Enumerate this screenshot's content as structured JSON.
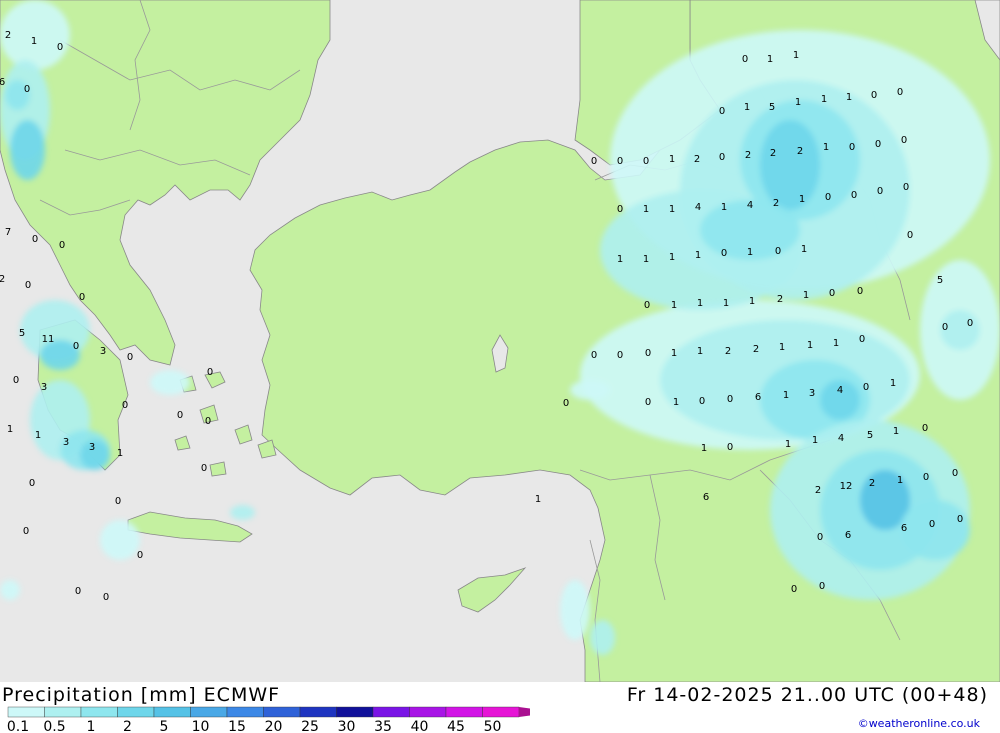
{
  "header": {
    "title": "Precipitation [mm] ECMWF",
    "valid_time": "Fr 14-02-2025 21..00 UTC (00+48)",
    "credit": "©weatheronline.co.uk"
  },
  "colors": {
    "sea": "#e8e8e8",
    "land": "#c4f0a0",
    "border": "#999999",
    "coast": "#888888"
  },
  "legend": {
    "ticks": [
      "0.1",
      "0.5",
      "1",
      "2",
      "5",
      "10",
      "15",
      "20",
      "25",
      "30",
      "35",
      "40",
      "45",
      "50"
    ],
    "colors": [
      "#cdf8f8",
      "#aef0f0",
      "#8ee6ee",
      "#6ed6ea",
      "#55c2e6",
      "#4aa8e6",
      "#3c88e6",
      "#2f62d8",
      "#1e34c0",
      "#11119a",
      "#7a14e6",
      "#a814e6",
      "#d214e6",
      "#e614d6",
      "#aa1090"
    ]
  },
  "values": [
    "2",
    "1",
    "0",
    "6",
    "0",
    "7",
    "0",
    "0",
    "2",
    "0",
    "0",
    "5",
    "11",
    "0",
    "3",
    "0",
    "0",
    "3",
    "0",
    "0",
    "1",
    "1",
    "3",
    "3",
    "1",
    "0",
    "0",
    "0",
    "0",
    "0",
    "0",
    "0",
    "0",
    "0",
    "0",
    "1",
    "1",
    "0",
    "1",
    "5",
    "1",
    "1",
    "1",
    "0",
    "0",
    "0",
    "0",
    "0",
    "1",
    "2",
    "0",
    "2",
    "2",
    "2",
    "1",
    "0",
    "0",
    "0",
    "0",
    "1",
    "1",
    "4",
    "1",
    "4",
    "2",
    "1",
    "0",
    "0",
    "0",
    "0",
    "0",
    "1",
    "1",
    "1",
    "1",
    "0",
    "1",
    "0",
    "1",
    "5",
    "0",
    "0",
    "1",
    "1",
    "1",
    "1",
    "2",
    "1",
    "0",
    "0",
    "0",
    "0",
    "0",
    "1",
    "1",
    "2",
    "2",
    "1",
    "1",
    "1",
    "0",
    "0",
    "0",
    "1",
    "0",
    "0",
    "6",
    "1",
    "3",
    "4",
    "0",
    "1",
    "0",
    "1",
    "0",
    "1",
    "1",
    "4",
    "5",
    "1",
    "0",
    "2",
    "12",
    "2",
    "1",
    "0",
    "0",
    "1",
    "6",
    "0",
    "6",
    "6",
    "0",
    "0",
    "0",
    "0"
  ]
}
